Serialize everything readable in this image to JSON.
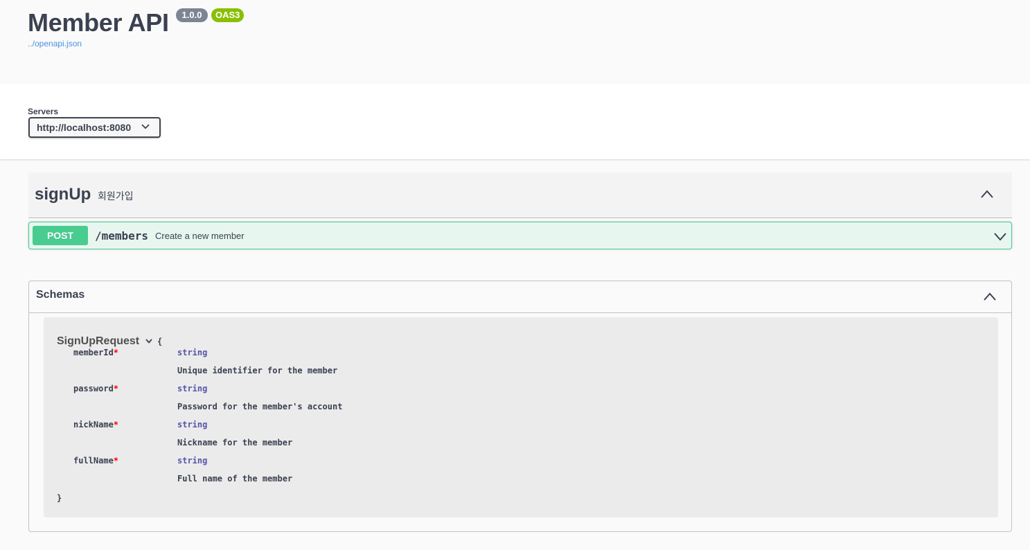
{
  "info": {
    "title": "Member API",
    "version": "1.0.0",
    "spec_badge": "OAS3",
    "spec_link": "../openapi.json"
  },
  "servers": {
    "label": "Servers",
    "selected": "http://localhost:8080"
  },
  "tag": {
    "name": "signUp",
    "description": "회원가입"
  },
  "operation": {
    "method": "POST",
    "path": "/members",
    "summary": "Create a new member"
  },
  "schemas": {
    "title": "Schemas",
    "model": {
      "name": "SignUpRequest",
      "open_brace": "{",
      "close_brace": "}",
      "properties": [
        {
          "name": "memberId",
          "required": "*",
          "type": "string",
          "description": "Unique identifier for the member"
        },
        {
          "name": "password",
          "required": "*",
          "type": "string",
          "description": "Password for the member's account"
        },
        {
          "name": "nickName",
          "required": "*",
          "type": "string",
          "description": "Nickname for the member"
        },
        {
          "name": "fullName",
          "required": "*",
          "type": "string",
          "description": "Full name of the member"
        }
      ]
    }
  },
  "colors": {
    "post": "#49cc90",
    "post_bg": "#e8f6f0",
    "version_badge": "#7d8492",
    "oas_badge": "#89bf04",
    "link": "#4990e2"
  }
}
